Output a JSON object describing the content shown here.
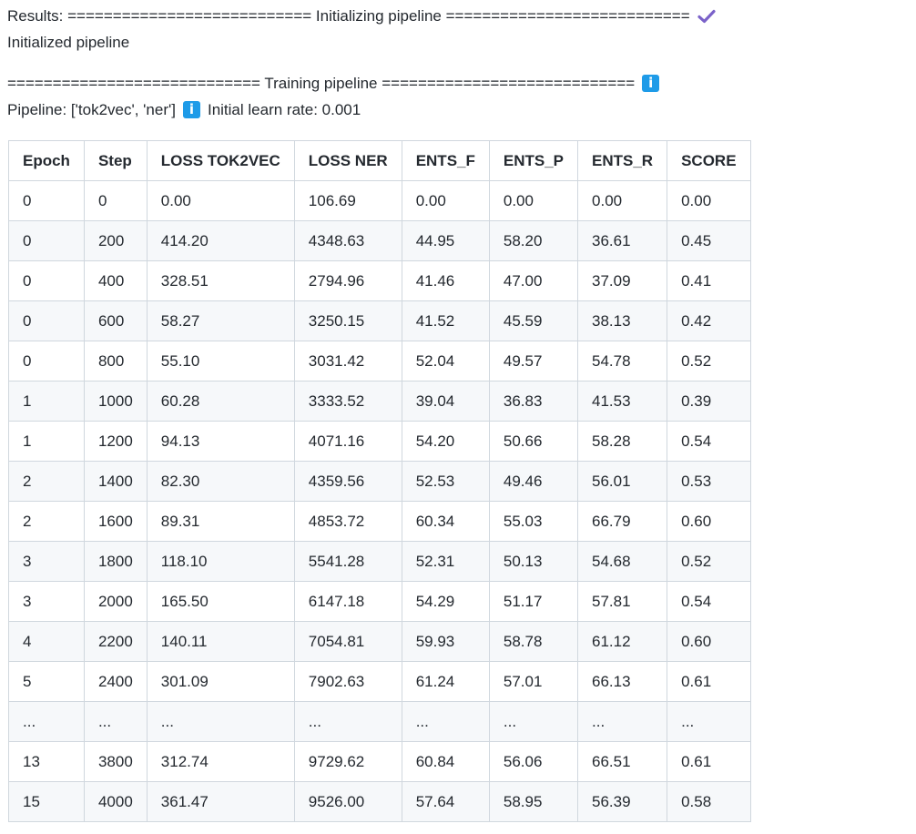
{
  "log": {
    "results_line": "Results: =========================== Initializing pipeline ===========================",
    "initialized": "Initialized pipeline",
    "training_header": "============================ Training pipeline ============================",
    "pipeline_text": "Pipeline: ['tok2vec', 'ner']",
    "learn_rate_text": "Initial learn rate: 0.001",
    "info_icon": "i",
    "icons": {
      "check": "check-icon",
      "info": "info-icon"
    },
    "colors": {
      "check": "#7b62c9",
      "info": "#1e9be8"
    }
  },
  "table": {
    "headers": [
      "Epoch",
      "Step",
      "LOSS TOK2VEC",
      "LOSS NER",
      "ENTS_F",
      "ENTS_P",
      "ENTS_R",
      "SCORE"
    ],
    "rows": [
      [
        "0",
        "0",
        "0.00",
        "106.69",
        "0.00",
        "0.00",
        "0.00",
        "0.00"
      ],
      [
        "0",
        "200",
        "414.20",
        "4348.63",
        "44.95",
        "58.20",
        "36.61",
        "0.45"
      ],
      [
        "0",
        "400",
        "328.51",
        "2794.96",
        "41.46",
        "47.00",
        "37.09",
        "0.41"
      ],
      [
        "0",
        "600",
        "58.27",
        "3250.15",
        "41.52",
        "45.59",
        "38.13",
        "0.42"
      ],
      [
        "0",
        "800",
        "55.10",
        "3031.42",
        "52.04",
        "49.57",
        "54.78",
        "0.52"
      ],
      [
        "1",
        "1000",
        "60.28",
        "3333.52",
        "39.04",
        "36.83",
        "41.53",
        "0.39"
      ],
      [
        "1",
        "1200",
        "94.13",
        "4071.16",
        "54.20",
        "50.66",
        "58.28",
        "0.54"
      ],
      [
        "2",
        "1400",
        "82.30",
        "4359.56",
        "52.53",
        "49.46",
        "56.01",
        "0.53"
      ],
      [
        "2",
        "1600",
        "89.31",
        "4853.72",
        "60.34",
        "55.03",
        "66.79",
        "0.60"
      ],
      [
        "3",
        "1800",
        "118.10",
        "5541.28",
        "52.31",
        "50.13",
        "54.68",
        "0.52"
      ],
      [
        "3",
        "2000",
        "165.50",
        "6147.18",
        "54.29",
        "51.17",
        "57.81",
        "0.54"
      ],
      [
        "4",
        "2200",
        "140.11",
        "7054.81",
        "59.93",
        "58.78",
        "61.12",
        "0.60"
      ],
      [
        "5",
        "2400",
        "301.09",
        "7902.63",
        "61.24",
        "57.01",
        "66.13",
        "0.61"
      ],
      [
        "...",
        "...",
        "...",
        "...",
        "...",
        "...",
        "...",
        "..."
      ],
      [
        "13",
        "3800",
        "312.74",
        "9729.62",
        "60.84",
        "56.06",
        "66.51",
        "0.61"
      ],
      [
        "15",
        "4000",
        "361.47",
        "9526.00",
        "57.64",
        "58.95",
        "56.39",
        "0.58"
      ]
    ]
  }
}
